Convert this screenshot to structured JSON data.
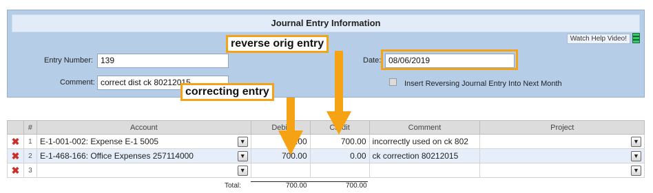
{
  "panel": {
    "title": "Journal Entry Information",
    "help_link": "Watch Help Video!",
    "entry_number_label": "Entry Number:",
    "entry_number_value": "139",
    "comment_label": "Comment:",
    "comment_value": "correct dist ck 80212015",
    "date_label": "Date:",
    "date_value": "08/06/2019",
    "reversing_label": "Insert Reversing Journal Entry Into Next Month"
  },
  "grid": {
    "columns": [
      "#",
      "Account",
      "Debit",
      "Credit",
      "Comment",
      "Project"
    ],
    "rows": [
      {
        "num": "1",
        "account": "E-1-001-002: Expense E-1 5005",
        "debit": ".00",
        "credit": "700.00",
        "comment": "incorrectly used on ck 802",
        "project": ""
      },
      {
        "num": "2",
        "account": "E-1-468-166: Office Expenses 257114000",
        "debit": "700.00",
        "credit": "0.00",
        "comment": "ck correction 80212015",
        "project": ""
      },
      {
        "num": "3",
        "account": "",
        "debit": "",
        "credit": "",
        "comment": "",
        "project": ""
      }
    ],
    "total_label": "Total:",
    "total_debit": "700.00",
    "total_credit": "700.00"
  },
  "annotations": {
    "reverse_label": "reverse orig entry",
    "correcting_label": "correcting entry",
    "accent_color": "#f5a314"
  },
  "icons": {
    "delete": "delete-x-icon",
    "dropdown": "chevron-down-icon",
    "video": "film-icon"
  }
}
